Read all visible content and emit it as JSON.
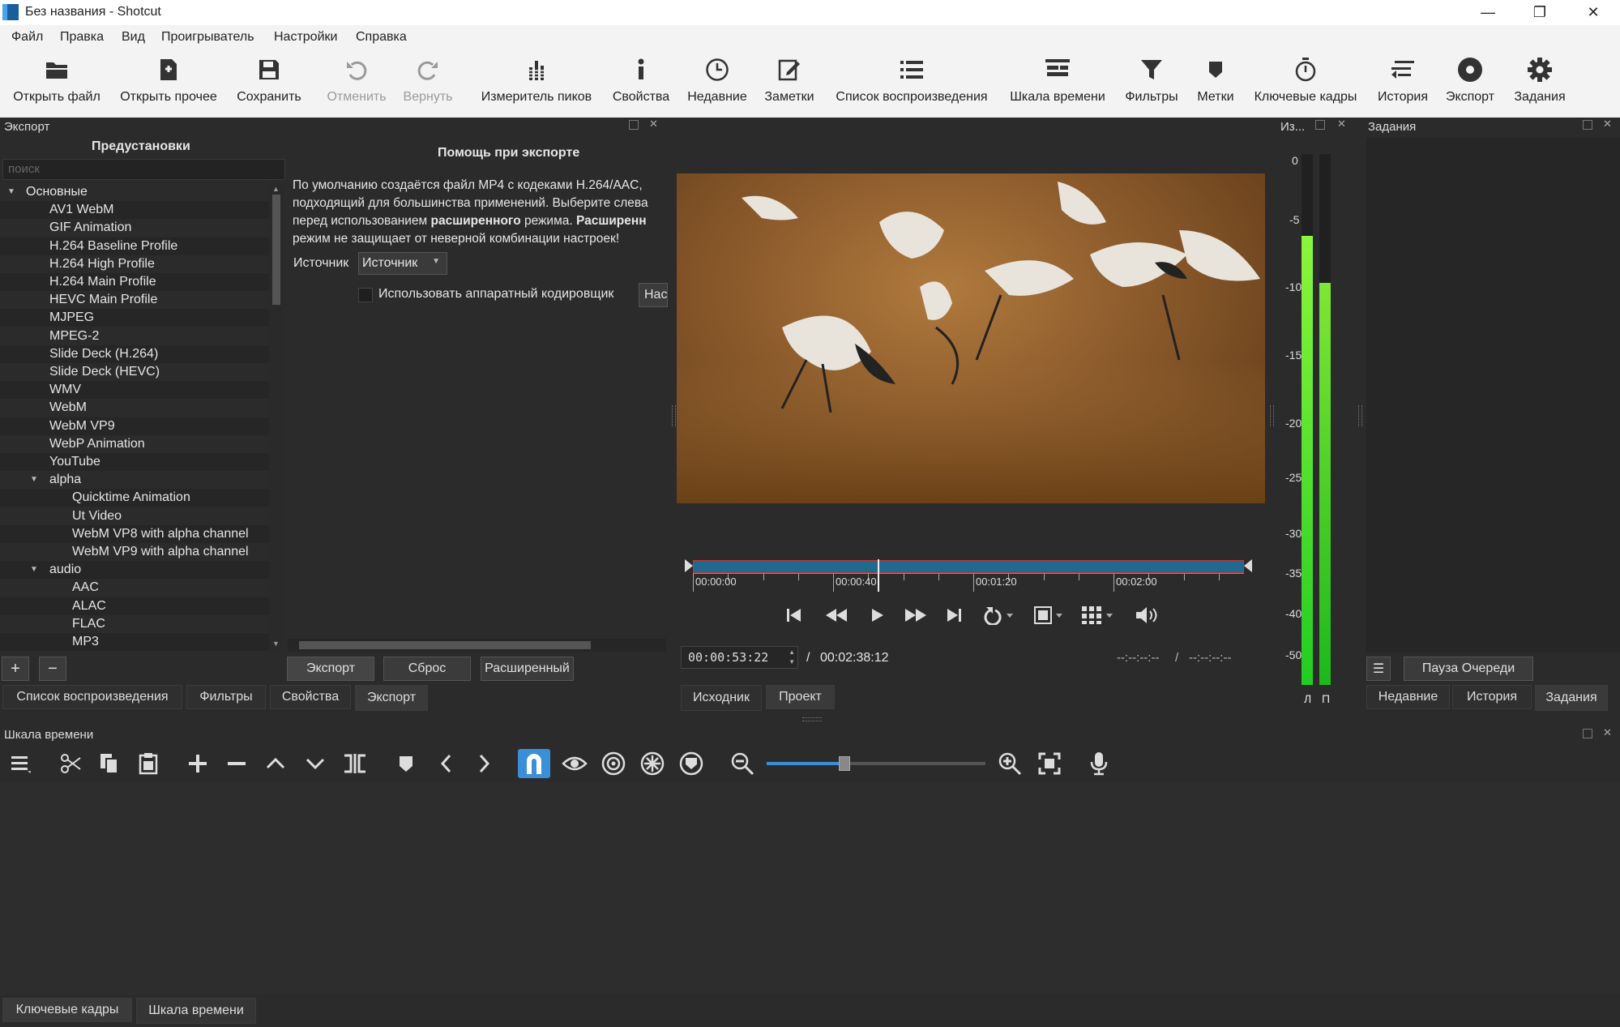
{
  "window": {
    "title": "Без названия - Shotcut",
    "min": "—",
    "max": "❐",
    "close": "✕"
  },
  "menu": [
    "Файл",
    "Правка",
    "Вид",
    "Проигрыватель",
    "Настройки",
    "Справка"
  ],
  "toolbar": [
    {
      "label": "Открыть файл",
      "icon": "open-file-icon"
    },
    {
      "label": "Открыть прочее",
      "icon": "open-other-icon"
    },
    {
      "label": "Сохранить",
      "icon": "save-icon"
    },
    {
      "label": "Отменить",
      "icon": "undo-icon",
      "disabled": true
    },
    {
      "label": "Вернуть",
      "icon": "redo-icon",
      "disabled": true
    },
    {
      "label": "Измеритель пиков",
      "icon": "peak-meter-icon"
    },
    {
      "label": "Свойства",
      "icon": "info-icon"
    },
    {
      "label": "Недавние",
      "icon": "clock-icon"
    },
    {
      "label": "Заметки",
      "icon": "notes-icon"
    },
    {
      "label": "Список воспроизведения",
      "icon": "playlist-icon"
    },
    {
      "label": "Шкала времени",
      "icon": "timeline-icon"
    },
    {
      "label": "Фильтры",
      "icon": "filter-icon"
    },
    {
      "label": "Метки",
      "icon": "marker-icon"
    },
    {
      "label": "Ключевые кадры",
      "icon": "stopwatch-icon"
    },
    {
      "label": "История",
      "icon": "history-icon"
    },
    {
      "label": "Экспорт",
      "icon": "export-icon"
    },
    {
      "label": "Задания",
      "icon": "gear-icon"
    }
  ],
  "export_panel": {
    "title": "Экспорт",
    "presets_header": "Предустановки",
    "search_placeholder": "поиск",
    "help_header": "Помощь при экспорте",
    "help_lines": [
      "По умолчанию создаётся файл MP4 с кодеками H.264/AAC,",
      "подходящий для большинства применений. Выберите слева",
      "перед использованием <b>расширенного</b> режима. <b>Расширенн</b>",
      "режим не защищает от неверной комбинации настроек!"
    ],
    "source_label": "Источник",
    "source_value": "Источник",
    "hw_encoder_label": "Использовать аппаратный кодировщик",
    "hw_config_button": "Нас",
    "tree": [
      {
        "label": "Основные",
        "level": 0,
        "expander": true
      },
      {
        "label": "AV1 WebM",
        "level": 1
      },
      {
        "label": "GIF Animation",
        "level": 1
      },
      {
        "label": "H.264 Baseline Profile",
        "level": 1
      },
      {
        "label": "H.264 High Profile",
        "level": 1
      },
      {
        "label": "H.264 Main Profile",
        "level": 1
      },
      {
        "label": "HEVC Main Profile",
        "level": 1
      },
      {
        "label": "MJPEG",
        "level": 1
      },
      {
        "label": "MPEG-2",
        "level": 1
      },
      {
        "label": "Slide Deck (H.264)",
        "level": 1
      },
      {
        "label": "Slide Deck (HEVC)",
        "level": 1
      },
      {
        "label": "WMV",
        "level": 1
      },
      {
        "label": "WebM",
        "level": 1
      },
      {
        "label": "WebM VP9",
        "level": 1
      },
      {
        "label": "WebP Animation",
        "level": 1
      },
      {
        "label": "YouTube",
        "level": 1
      },
      {
        "label": "alpha",
        "level": 1,
        "expander": true
      },
      {
        "label": "Quicktime Animation",
        "level": 2
      },
      {
        "label": "Ut Video",
        "level": 2
      },
      {
        "label": "WebM VP8 with alpha channel",
        "level": 2
      },
      {
        "label": "WebM VP9 with alpha channel",
        "level": 2
      },
      {
        "label": "audio",
        "level": 1,
        "expander": true
      },
      {
        "label": "AAC",
        "level": 2
      },
      {
        "label": "ALAC",
        "level": 2
      },
      {
        "label": "FLAC",
        "level": 2
      },
      {
        "label": "MP3",
        "level": 2
      }
    ],
    "add_button": "+",
    "remove_button": "−",
    "export_button": "Экспорт",
    "reset_button": "Сброс",
    "advanced_button": "Расширенный"
  },
  "left_tabs": [
    "Список воспроизведения",
    "Фильтры",
    "Свойства",
    "Экспорт"
  ],
  "player": {
    "ruler_labels": [
      "00:00:00",
      "00:00:40",
      "00:01:20",
      "00:02:00"
    ],
    "position_fraction": 0.336,
    "current_time": "00:00:53:22",
    "separator": "/",
    "duration": "00:02:38:12",
    "in_point": "--:--:--:--",
    "out_point": "--:--:--:--",
    "tabs": [
      "Исходник",
      "Проект"
    ],
    "controls": [
      "skip-start-icon",
      "rewind-icon",
      "play-icon",
      "fast-forward-icon",
      "skip-end-icon",
      "loop-icon",
      "zoom-fit-icon",
      "grid-icon",
      "volume-icon"
    ]
  },
  "meter": {
    "title": "Из...",
    "scale": [
      "0",
      "-5",
      "-10",
      "-15",
      "-20",
      "-25",
      "-30",
      "-35",
      "-40",
      "-50"
    ],
    "channels": [
      "Л",
      "П"
    ],
    "left_level_db": -6.2,
    "right_level_db": -9.7,
    "meter_color": "#22cc22"
  },
  "jobs": {
    "title": "Задания",
    "menu_icon": "menu-icon",
    "pause_button": "Пауза Очереди",
    "tabs": [
      "Недавние",
      "История",
      "Задания"
    ]
  },
  "timeline": {
    "title": "Шкала времени",
    "tools": [
      "menu-icon",
      "cut-icon",
      "copy-icon",
      "paste-icon",
      "append-icon",
      "remove-icon",
      "lift-icon",
      "overwrite-icon",
      "split-icon",
      "marker-icon",
      "prev-marker-icon",
      "next-marker-icon",
      "snap-icon",
      "scrub-icon",
      "ripple-icon",
      "ripple-all-icon",
      "ripple-markers-icon",
      "zoom-out-icon",
      "zoom-slider",
      "zoom-in-icon",
      "zoom-fit-icon",
      "record-audio-icon"
    ],
    "zoom_fraction": 0.35,
    "accent": "#3a8fd8"
  },
  "bottom_tabs": [
    "Ключевые кадры",
    "Шкала времени"
  ]
}
